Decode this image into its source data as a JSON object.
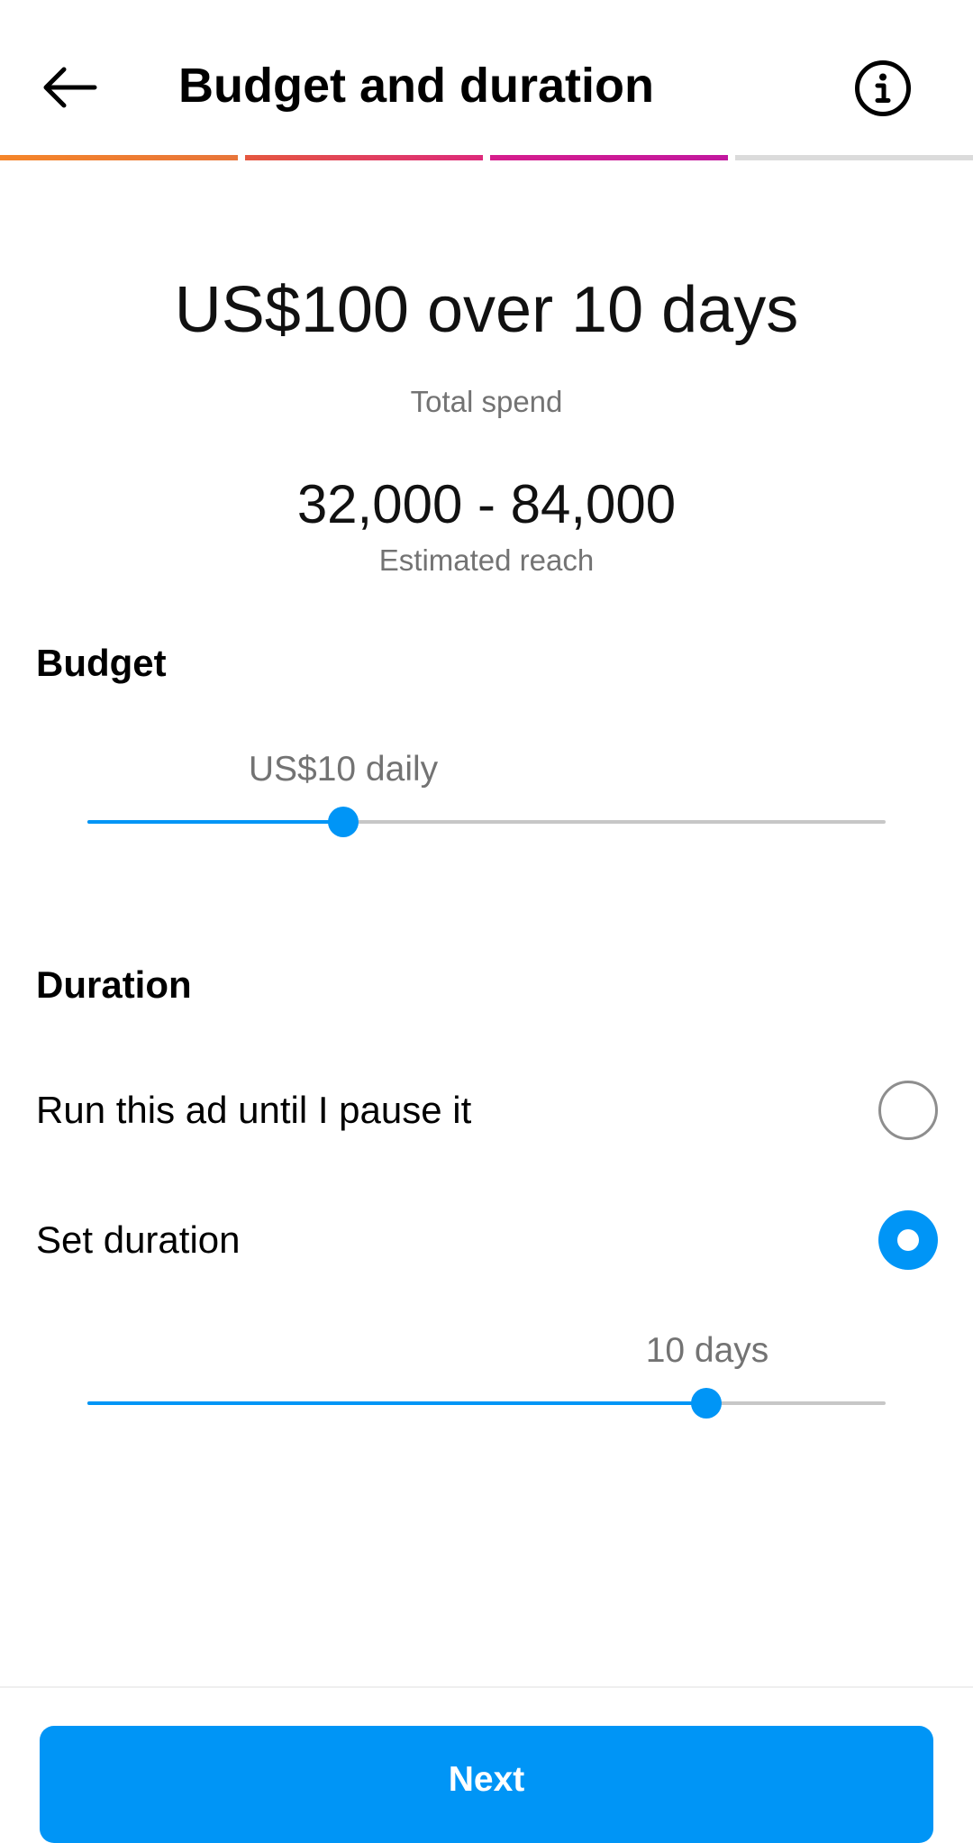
{
  "header": {
    "title": "Budget and duration",
    "back_icon": "arrow-left-icon",
    "info_icon": "info-circle-icon"
  },
  "progress": {
    "total_steps": 4,
    "completed_steps": 3,
    "colors": [
      "#f58529",
      "#dd2a7b",
      "#c2189f",
      "#dbdbdb"
    ]
  },
  "summary": {
    "title": "US$100 over 10 days",
    "subtitle": "Total spend",
    "reach_range": "32,000 - 84,000",
    "reach_label": "Estimated reach"
  },
  "budget": {
    "heading": "Budget",
    "value_label": "US$10 daily",
    "slider_fraction": 0.32
  },
  "duration": {
    "heading": "Duration",
    "options": [
      {
        "label": "Run this ad until I pause it",
        "selected": false
      },
      {
        "label": "Set duration",
        "selected": true
      }
    ],
    "value_label": "10 days",
    "slider_fraction": 0.775
  },
  "footer": {
    "next_label": "Next"
  },
  "colors": {
    "accent": "#0095f6",
    "secondary_text": "#737373",
    "track": "#c7c7c7"
  }
}
